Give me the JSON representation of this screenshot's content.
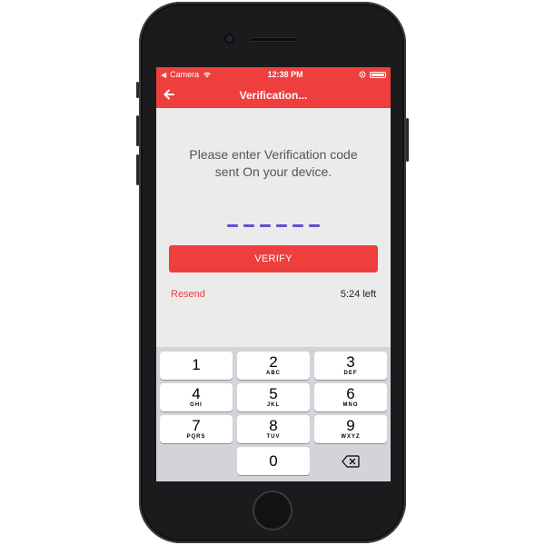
{
  "status_bar": {
    "carrier": "Camera",
    "time": "12:38 PM"
  },
  "nav": {
    "title": "Verification..."
  },
  "message": {
    "line1": "Please enter Verification code",
    "line2": "sent On your device."
  },
  "verify_label": "VERIFY",
  "resend_label": "Resend",
  "timer_text": "5:24 left",
  "keypad": {
    "rows": [
      [
        {
          "num": "1",
          "letters": ""
        },
        {
          "num": "2",
          "letters": "ABC"
        },
        {
          "num": "3",
          "letters": "DEF"
        }
      ],
      [
        {
          "num": "4",
          "letters": "GHI"
        },
        {
          "num": "5",
          "letters": "JKL"
        },
        {
          "num": "6",
          "letters": "MNO"
        }
      ],
      [
        {
          "num": "7",
          "letters": "PQRS"
        },
        {
          "num": "8",
          "letters": "TUV"
        },
        {
          "num": "9",
          "letters": "WXYZ"
        }
      ]
    ],
    "zero": "0"
  },
  "colors": {
    "accent": "#ee3e3e",
    "dash": "#6d4bd3"
  }
}
